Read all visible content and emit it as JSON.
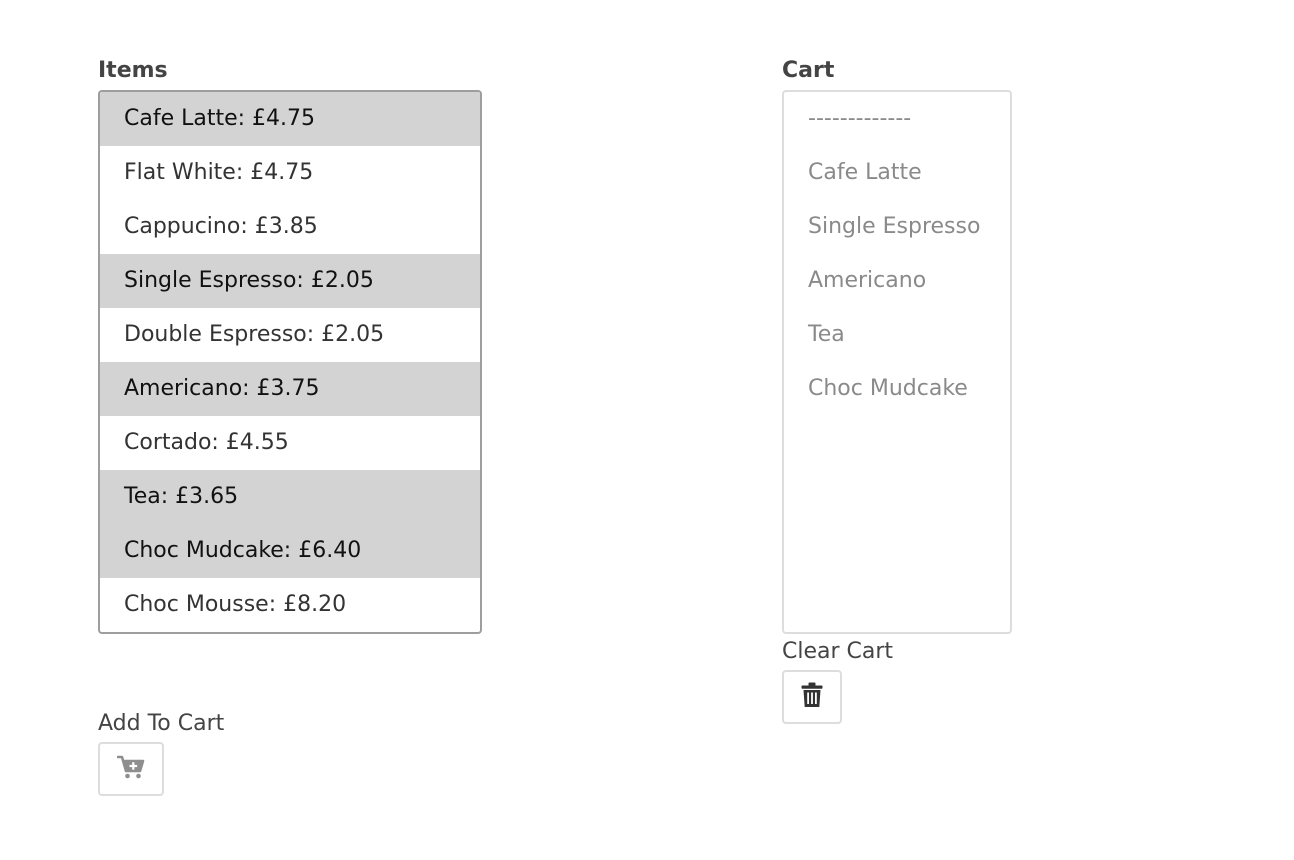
{
  "items": {
    "label": "Items",
    "options": [
      {
        "text": "Cafe Latte: £4.75",
        "selected": true
      },
      {
        "text": "Flat White: £4.75",
        "selected": false
      },
      {
        "text": "Cappucino: £3.85",
        "selected": false
      },
      {
        "text": "Single Espresso: £2.05",
        "selected": true
      },
      {
        "text": "Double Espresso: £2.05",
        "selected": false
      },
      {
        "text": "Americano: £3.75",
        "selected": true
      },
      {
        "text": "Cortado: £4.55",
        "selected": false
      },
      {
        "text": "Tea: £3.65",
        "selected": true
      },
      {
        "text": "Choc Mudcake: £6.40",
        "selected": true
      },
      {
        "text": "Choc Mousse: £8.20",
        "selected": false
      }
    ]
  },
  "cart": {
    "label": "Cart",
    "options": [
      {
        "text": "-------------"
      },
      {
        "text": "Cafe Latte"
      },
      {
        "text": "Single Espresso"
      },
      {
        "text": "Americano"
      },
      {
        "text": "Tea"
      },
      {
        "text": "Choc Mudcake"
      }
    ]
  },
  "add_to_cart": {
    "label": "Add To Cart",
    "icon": "cart-plus-icon"
  },
  "clear_cart": {
    "label": "Clear Cart",
    "icon": "trash-icon"
  },
  "colors": {
    "selected_bg": "#d3d3d3",
    "cart_text": "#8a8a8a"
  }
}
